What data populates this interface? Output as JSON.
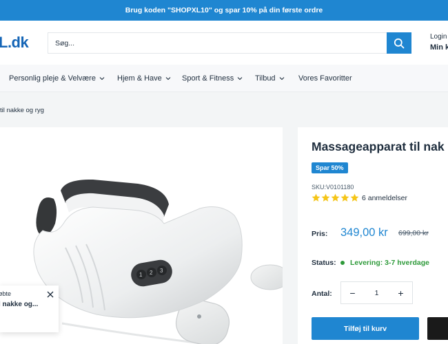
{
  "announcement": "Brug koden \"SHOPXL10\" og spar 10% på din første ordre",
  "header": {
    "logo": "L.dk",
    "search_placeholder": "Søg...",
    "login_label": "Login",
    "account_label": "Min k"
  },
  "nav": {
    "items": [
      {
        "label": "Personlig pleje & Velvære",
        "has_dropdown": true
      },
      {
        "label": "Hjem & Have",
        "has_dropdown": true
      },
      {
        "label": "Sport & Fitness",
        "has_dropdown": true
      },
      {
        "label": "Tilbud",
        "has_dropdown": true
      },
      {
        "label": "Vores Favoritter",
        "has_dropdown": false
      }
    ]
  },
  "breadcrumb": "til nakke og ryg",
  "product": {
    "title": "Massageapparat til nak",
    "badge": "Spar 50%",
    "sku": "SKU:V0101180",
    "rating_stars": 5,
    "reviews": "6 anmeldelser",
    "price_label": "Pris:",
    "price": "349,00 kr",
    "old_price": "699,00 kr",
    "status_label": "Status:",
    "status": "Levering: 3-7 hverdage",
    "quantity_label": "Antal:",
    "quantity": "1",
    "qty_minus": "−",
    "qty_plus": "+",
    "add_to_cart": "Tilføj til kurv"
  },
  "popup": {
    "line1": "øbte",
    "line2": "l nakke og..."
  },
  "colors": {
    "accent": "#1f86d1",
    "stock_green": "#2e9a3a",
    "star_gold": "#f5c518"
  }
}
